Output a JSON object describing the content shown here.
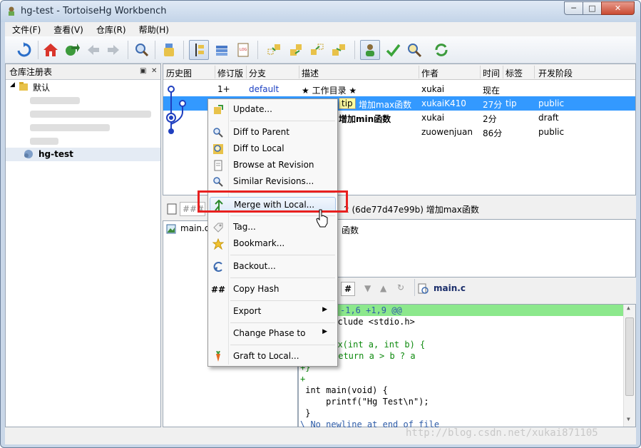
{
  "window": {
    "title": "hg-test - TortoiseHg Workbench"
  },
  "menubar": [
    "文件(F)",
    "查看(V)",
    "仓库(R)",
    "帮助(H)"
  ],
  "left_panel": {
    "title": "仓库注册表",
    "tree": {
      "root_label": "默认",
      "selected_repo": "hg-test"
    }
  },
  "graph": {
    "columns": [
      "历史图",
      "修订版",
      "分支",
      "描述",
      "作者",
      "时间",
      "标签",
      "开发阶段"
    ],
    "rows": [
      {
        "rev": "1+",
        "branch": "default",
        "desc": "★ 工作目录 ★",
        "author": "xukai",
        "time": "现在",
        "tags": "",
        "phase": ""
      },
      {
        "rev": "",
        "branch": "",
        "desc_tag": "tip",
        "desc": "增加max函数",
        "author": "xukaiK410",
        "time": "27分",
        "tags": "tip",
        "phase": "public"
      },
      {
        "rev": "",
        "branch": "",
        "desc": "增加min函数",
        "author": "xukai",
        "time": "2分",
        "tags": "",
        "phase": "draft"
      },
      {
        "rev": "",
        "branch": "",
        "desc": "",
        "author": "zuowenjuan",
        "time": "86分",
        "tags": "",
        "phase": "public"
      }
    ]
  },
  "revision_info": {
    "filter_placeholder": "###",
    "summary_suffix": "2 (6de77d47e99b) 增加max函数",
    "message_suffix": "函数"
  },
  "files": {
    "first_file": "main.c"
  },
  "diff": {
    "filename": "main.c",
    "hash_button": "#",
    "lines": [
      {
        "text": "-1,6 +1,9 @@",
        "kind": "hunk"
      },
      {
        "text": "include <stdio.h>",
        "kind": "normal"
      },
      {
        "text": "",
        "kind": "normal"
      },
      {
        "text": "max(int a, int b) {",
        "kind": "add"
      },
      {
        "text": "return a > b ? a",
        "kind": "add"
      },
      {
        "text": "+}",
        "kind": "add"
      },
      {
        "text": "+",
        "kind": "add"
      },
      {
        "text": " int main(void) {",
        "kind": "normal"
      },
      {
        "text": "     printf(\"Hg Test\\n\");",
        "kind": "normal"
      },
      {
        "text": " }",
        "kind": "normal"
      },
      {
        "text": "\\ No newline at end of file",
        "kind": "normal"
      }
    ]
  },
  "context_menu": {
    "items": [
      {
        "label": "Update...",
        "icon": "update-icon"
      },
      {
        "label": "Diff to Parent",
        "icon": "diff-parent-icon"
      },
      {
        "label": "Diff to Local",
        "icon": "diff-local-icon"
      },
      {
        "label": "Browse at Revision",
        "icon": "browse-icon"
      },
      {
        "label": "Similar Revisions...",
        "icon": "similar-icon"
      },
      {
        "label": "Merge with Local...",
        "icon": "merge-icon"
      },
      {
        "label": "Tag...",
        "icon": "tag-icon"
      },
      {
        "label": "Bookmark...",
        "icon": "bookmark-icon"
      },
      {
        "label": "Backout...",
        "icon": "backout-icon"
      },
      {
        "label": "Copy Hash",
        "icon": "hash-icon"
      },
      {
        "label": "Export",
        "icon": ""
      },
      {
        "label": "Change Phase to",
        "icon": ""
      },
      {
        "label": "Graft to Local...",
        "icon": "graft-icon"
      }
    ]
  },
  "watermark": "http://blog.csdn.net/xukai871105"
}
